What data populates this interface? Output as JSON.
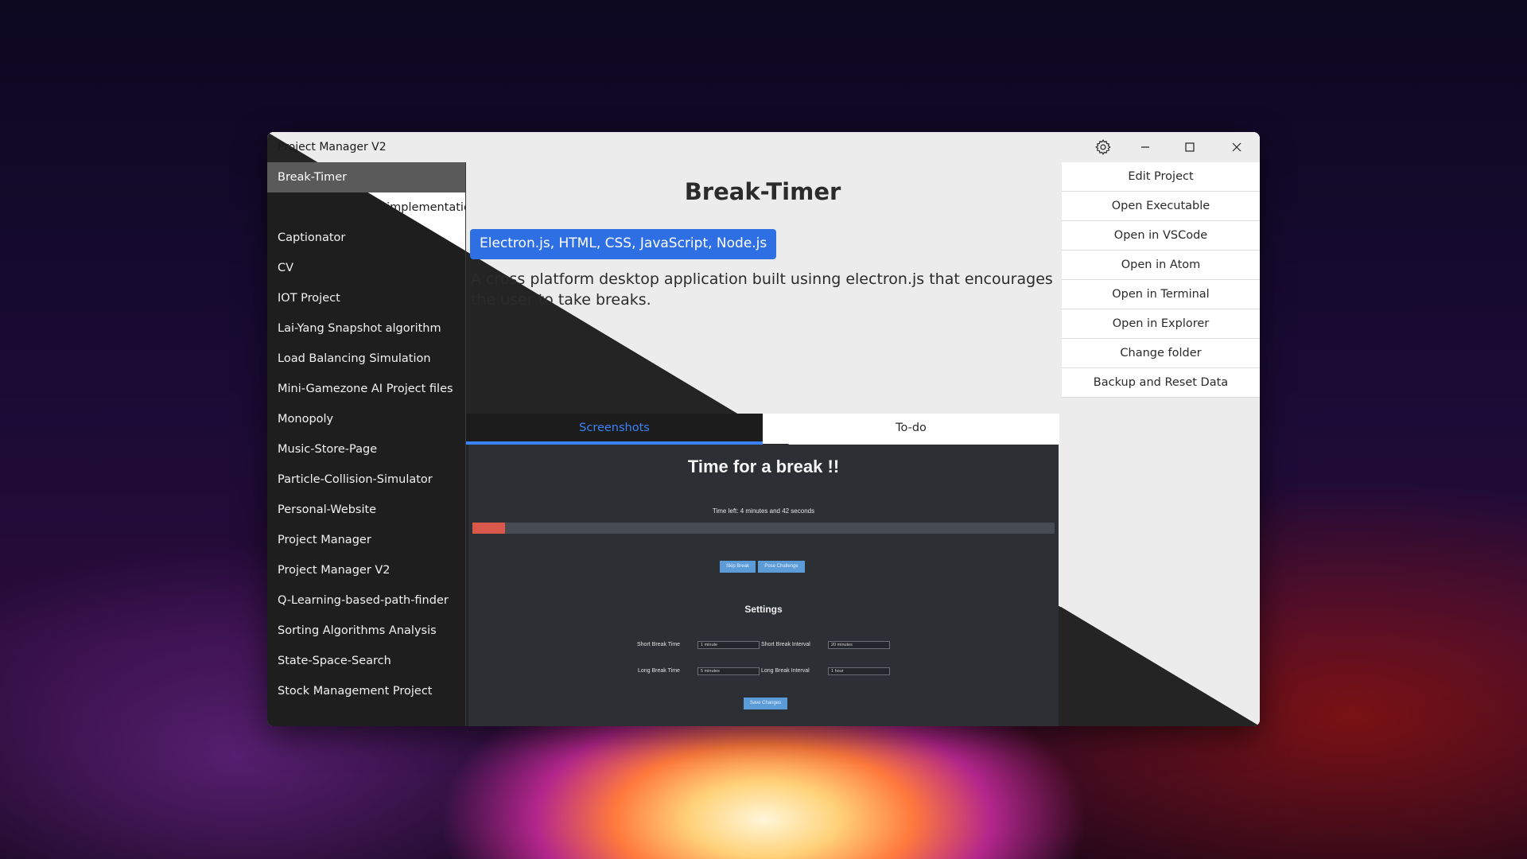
{
  "window": {
    "title": "Project Manager V2",
    "icons": {
      "settings": "gear-icon",
      "minimize": "minimize-icon",
      "maximize": "maximize-icon",
      "close": "close-icon"
    }
  },
  "sidebar": {
    "active_index": 0,
    "items": [
      {
        "label": "Break-Timer"
      },
      {
        "label": "Browser linked list implementation"
      },
      {
        "label": "Captionator"
      },
      {
        "label": "CV"
      },
      {
        "label": "IOT Project"
      },
      {
        "label": "Lai-Yang Snapshot algorithm"
      },
      {
        "label": "Load Balancing Simulation"
      },
      {
        "label": "Mini-Gamezone AI Project files"
      },
      {
        "label": "Monopoly"
      },
      {
        "label": "Music-Store-Page"
      },
      {
        "label": "Particle-Collision-Simulator"
      },
      {
        "label": "Personal-Website"
      },
      {
        "label": "Project Manager"
      },
      {
        "label": "Project Manager V2"
      },
      {
        "label": "Q-Learning-based-path-finder"
      },
      {
        "label": "Sorting Algorithms Analysis"
      },
      {
        "label": "State-Space-Search"
      },
      {
        "label": "Stock Management Project"
      }
    ]
  },
  "project": {
    "title": "Break-Timer",
    "tech": "Electron.js, HTML, CSS, JavaScript, Node.js",
    "description": "A cross platform desktop application built usinng electron.js that encourages the user to take breaks."
  },
  "actions": [
    {
      "label": "Edit Project"
    },
    {
      "label": "Open Executable"
    },
    {
      "label": "Open in VSCode"
    },
    {
      "label": "Open in Atom"
    },
    {
      "label": "Open in Terminal"
    },
    {
      "label": "Open in Explorer"
    },
    {
      "label": "Change folder"
    },
    {
      "label": "Backup and Reset Data"
    }
  ],
  "tabs": [
    {
      "label": "Screenshots",
      "active": true
    },
    {
      "label": "To-do",
      "active": false
    }
  ],
  "screenshot": {
    "title": "Time for a break !!",
    "time_left": "Time left: 4 minutes and 42 seconds",
    "progress_fraction": 0.056,
    "buttons": {
      "skip": "Skip Break",
      "challenge": "Pose Challenge",
      "save": "Save Changes"
    },
    "settings_heading": "Settings",
    "fields": {
      "short_break_time": {
        "label": "Short Break Time",
        "value": "1 minute"
      },
      "short_break_interval": {
        "label": "Short Break Interval",
        "value": "20 minutes"
      },
      "long_break_time": {
        "label": "Long Break Time",
        "value": "5 minutes"
      },
      "long_break_interval": {
        "label": "Long Break Interval",
        "value": "1 hour"
      }
    }
  },
  "colors": {
    "accent": "#3b82f6",
    "badge": "#2f6fe4",
    "dark_panel": "#1f1f1f",
    "light_panel": "#ececec",
    "progress": "#d9574b"
  }
}
